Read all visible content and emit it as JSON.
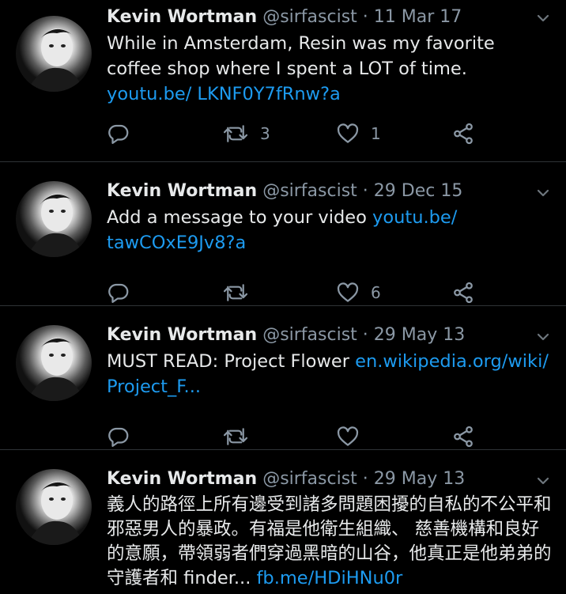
{
  "tweets": [
    {
      "author": "Kevin Wortman",
      "handle": "@sirfascist",
      "separator": "·",
      "date": "11 Mar 17",
      "text": "While in Amsterdam, Resin was my favorite coffee shop where I spent a LOT of time. ",
      "link": "youtu.be/ LKNF0Y7fRnw?a",
      "retweets": "3",
      "likes": "1"
    },
    {
      "author": "Kevin Wortman",
      "handle": "@sirfascist",
      "separator": "·",
      "date": "29 Dec 15",
      "text": "Add a message to your video ",
      "link": "youtu.be/ tawCOxE9Jv8?a",
      "retweets": "",
      "likes": "6"
    },
    {
      "author": "Kevin Wortman",
      "handle": "@sirfascist",
      "separator": "·",
      "date": "29 May 13",
      "text": "MUST READ: Project Flower ",
      "link": "en.wikipedia.org/wiki/ Project_F...",
      "retweets": "",
      "likes": ""
    },
    {
      "author": "Kevin Wortman",
      "handle": "@sirfascist",
      "separator": "·",
      "date": "29 May 13",
      "text": "義人的路徑上所有邊受到諸多問題困擾的自私的不公平和邪惡男人的暴政。有福是他衛生組織、 慈善機構和良好的意願，帶領弱者們穿過黑暗的山谷，他真正是他弟弟的守護者和 finder... ",
      "link": "fb.me/HDiHNu0r"
    }
  ],
  "icons": {
    "reply": "reply-icon",
    "retweet": "retweet-icon",
    "like": "heart-icon",
    "share": "share-icon",
    "caret": "chevron-down-icon"
  },
  "colors": {
    "background": "#000000",
    "text": "#e7e9ea",
    "muted": "#8b98a5",
    "link": "#1d9bf0",
    "divider": "#2f3336"
  }
}
